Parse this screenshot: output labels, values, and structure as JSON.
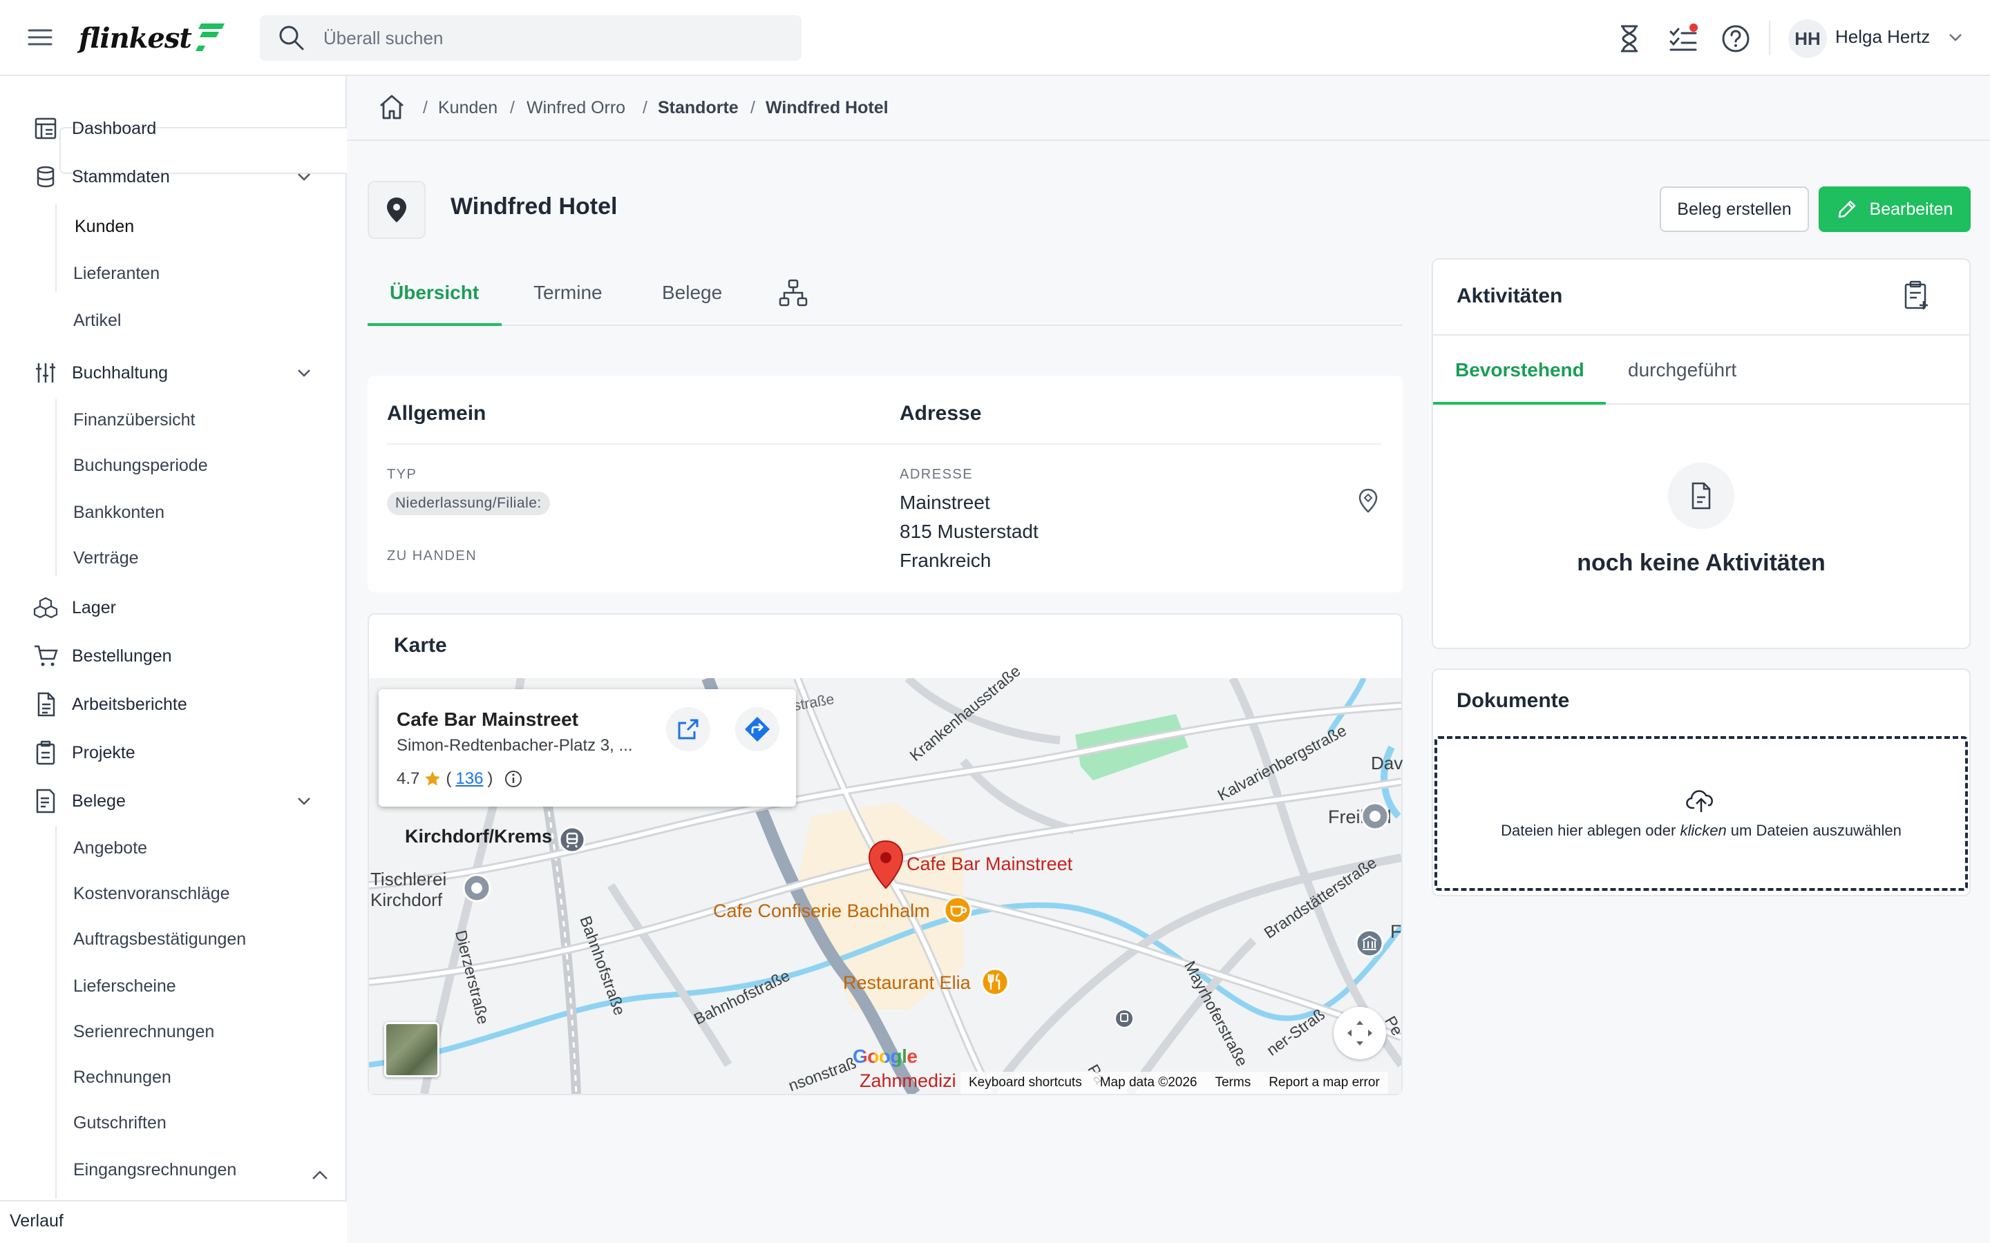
{
  "topbar": {
    "logo_text": "flinkest",
    "search_placeholder": "Überall suchen",
    "user_initials": "HH",
    "user_name": "Helga Hertz",
    "notification_color": "#e53935"
  },
  "sidebar": {
    "items": [
      {
        "label": "Dashboard",
        "icon": "dashboard-icon"
      },
      {
        "label": "Stammdaten",
        "icon": "database-icon"
      },
      {
        "label": "Buchhaltung",
        "icon": "sliders-icon"
      },
      {
        "label": "Lager",
        "icon": "boxes-icon"
      },
      {
        "label": "Bestellungen",
        "icon": "cart-icon"
      },
      {
        "label": "Arbeitsberichte",
        "icon": "report-icon"
      },
      {
        "label": "Projekte",
        "icon": "clipboard-icon"
      },
      {
        "label": "Belege",
        "icon": "receipt-icon"
      }
    ],
    "stammdaten_sub": [
      "Kunden",
      "Lieferanten",
      "Artikel"
    ],
    "buchhaltung_sub": [
      "Finanzübersicht",
      "Buchungsperiode",
      "Bankkonten",
      "Verträge"
    ],
    "belege_sub": [
      "Angebote",
      "Kostenvoranschläge",
      "Auftragsbestätigungen",
      "Lieferscheine",
      "Serienrechnungen",
      "Rechnungen",
      "Gutschriften",
      "Eingangsrechnungen"
    ],
    "footer": "Verlauf"
  },
  "breadcrumb": [
    "Kunden",
    "Winfred Orro",
    "Standorte",
    "Windfred Hotel"
  ],
  "page": {
    "title": "Windfred Hotel",
    "btn_beleg": "Beleg erstellen",
    "btn_edit": "Bearbeiten",
    "accent": "#1fbe5f",
    "tabs": [
      "Übersicht",
      "Termine",
      "Belege"
    ]
  },
  "allgemein": {
    "title": "Allgemein",
    "typ_label": "TYP",
    "typ_value": "Niederlassung/Filiale:",
    "zu_handen_label": "ZU HANDEN"
  },
  "adresse": {
    "title": "Adresse",
    "label": "ADRESSE",
    "lines": [
      "Mainstreet",
      "815 Musterstadt",
      "Frankreich"
    ]
  },
  "karte": {
    "title": "Karte",
    "popup": {
      "title": "Cafe Bar Mainstreet",
      "address": "Simon-Redtenbacher-Platz 3, ...",
      "rating": "4.7",
      "reviews": "136",
      "paren_open": "(",
      "paren_close": ")"
    },
    "labels": {
      "kirchdorf": "Kirchdorf/Krems",
      "tischlerei1": "Tischlerei",
      "tischlerei2": "Kirchdorf",
      "cafe_bar": "Cafe Bar Mainstreet",
      "confiserie": "Cafe Confiserie Bachhalm",
      "restaurant": "Restaurant Elia",
      "freibad": "Freibad",
      "dav": "Dav",
      "zahn": "Zahnmedizi",
      "s_kranken": "Krankenhausstraße",
      "s_kalvarien": "Kalvarienbergstraße",
      "s_brandstaetter": "Brandstätterstraße",
      "s_bahnhof1": "Bahnhofstraße",
      "s_bahnhof2": "Bahnhofstraße",
      "s_dierzer": "Dierzerstraße",
      "s_mayrhofer": "Mayrhoferstraße",
      "s_strasse": "straße",
      "s_ner": "ner-Straß",
      "s_nsonstr": "nsonstraß",
      "s_pa": "Pa",
      "s_pe": "Pe",
      "s_f": "F"
    },
    "google": "Google",
    "footer": [
      "Keyboard shortcuts",
      "Map data ©2026",
      "Terms",
      "Report a map error"
    ]
  },
  "aktivitaeten": {
    "title": "Aktivitäten",
    "tabs": [
      "Bevorstehend",
      "durchgeführt"
    ],
    "empty": "noch keine Aktivitäten"
  },
  "dokumente": {
    "title": "Dokumente",
    "drop_pre": "Dateien hier ablegen oder ",
    "drop_em": "klicken",
    "drop_post": " um Dateien auszuwählen"
  }
}
